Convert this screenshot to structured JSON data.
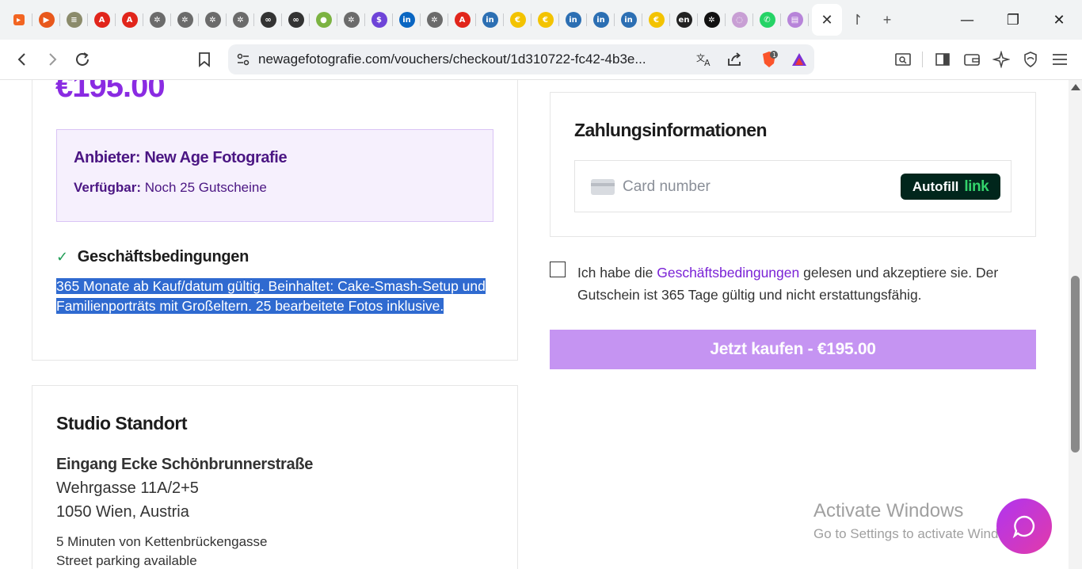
{
  "browser": {
    "tabs": [
      {
        "icon": "framer-icon",
        "glyph": "▸",
        "color": "#f26522"
      },
      {
        "icon": "play-circle-icon",
        "glyph": "▶",
        "color": "#e8581c"
      },
      {
        "icon": "lines-circle-icon",
        "glyph": "≡",
        "color": "#8b8b6b"
      },
      {
        "icon": "adobe-a-icon",
        "glyph": "A",
        "color": "#e1251b"
      },
      {
        "icon": "adobe-a-icon",
        "glyph": "A",
        "color": "#e1251b"
      },
      {
        "icon": "openai-gray-icon",
        "glyph": "✲",
        "color": "#6b6b6b"
      },
      {
        "icon": "openai-gray-icon",
        "glyph": "✲",
        "color": "#6b6b6b"
      },
      {
        "icon": "openai-gray-icon",
        "glyph": "✲",
        "color": "#6b6b6b"
      },
      {
        "icon": "openai-gray-icon",
        "glyph": "✲",
        "color": "#6b6b6b"
      },
      {
        "icon": "infinity-icon",
        "glyph": "∞",
        "color": "#333333"
      },
      {
        "icon": "infinity-icon",
        "glyph": "∞",
        "color": "#333333"
      },
      {
        "icon": "green-circle-icon",
        "glyph": "●",
        "color": "#7cb342"
      },
      {
        "icon": "openai-gray-icon",
        "glyph": "✲",
        "color": "#6b6b6b"
      },
      {
        "icon": "dollar-circle-icon",
        "glyph": "$",
        "color": "#6e44d8"
      },
      {
        "icon": "linkedin-icon",
        "glyph": "in",
        "color": "#0a66c2"
      },
      {
        "icon": "openai-gray-icon",
        "glyph": "✲",
        "color": "#6b6b6b"
      },
      {
        "icon": "adobe-a-icon",
        "glyph": "A",
        "color": "#e1251b"
      },
      {
        "icon": "linkedin-circle-icon",
        "glyph": "in",
        "color": "#2c6fb3"
      },
      {
        "icon": "euro-yellow-icon",
        "glyph": "€",
        "color": "#f3c300"
      },
      {
        "icon": "euro-yellow-icon",
        "glyph": "€",
        "color": "#f3c300"
      },
      {
        "icon": "linkedin-circle-icon",
        "glyph": "in",
        "color": "#2c6fb3"
      },
      {
        "icon": "linkedin-circle-icon",
        "glyph": "in",
        "color": "#2c6fb3"
      },
      {
        "icon": "linkedin-circle-icon",
        "glyph": "in",
        "color": "#2c6fb3"
      },
      {
        "icon": "euro-yellow-icon",
        "glyph": "€",
        "color": "#f3c300"
      },
      {
        "icon": "en-icon",
        "glyph": "en",
        "color": "#222222"
      },
      {
        "icon": "openai-icon",
        "glyph": "✲",
        "color": "#111111"
      },
      {
        "icon": "pink-circle-icon",
        "glyph": "◌",
        "color": "#c89fd4"
      },
      {
        "icon": "whatsapp-icon",
        "glyph": "✆",
        "color": "#25d366"
      },
      {
        "icon": "doc-purple-icon",
        "glyph": "▤",
        "color": "#b784d9"
      }
    ],
    "active_tab_close": "✕",
    "extra_tab": "↾",
    "new_tab": "+",
    "window": {
      "minimize": "—",
      "restore": "❐",
      "close": "✕"
    },
    "url": "newagefotografie.com/vouchers/checkout/1d310722-fc42-4b3e..."
  },
  "voucher": {
    "price": "€195.00",
    "provider_label": "Anbieter: New Age Fotografie",
    "available_label": "Verfügbar:",
    "available_value": "Noch 25 Gutscheine",
    "terms_heading": "Geschäftsbedingungen",
    "terms_text": "365 Monate ab Kauf/datum gültig. Beinhaltet: Cake-Smash-Setup und Familienporträts mit Großeltern. 25 bearbeitete Fotos inklusive."
  },
  "studio": {
    "title": "Studio Standort",
    "entrance": "Eingang Ecke Schönbrunnerstraße",
    "street": "Wehrgasse 11A/2+5",
    "city": "1050 Wien, Austria",
    "transit": "5 Minuten von Kettenbrückengasse",
    "parking": "Street parking available"
  },
  "payment": {
    "title": "Zahlungsinformationen",
    "card_placeholder": "Card number",
    "autofill_label": "Autofill",
    "autofill_brand": "link",
    "agree_prefix": "Ich habe die",
    "agree_link": "Geschäftsbedingungen",
    "agree_suffix": "gelesen und akzeptiere sie. Der Gutschein ist 365 Tage gültig und nicht erstattungsfähig.",
    "buy_button": "Jetzt kaufen - €195.00"
  },
  "os": {
    "activate_title": "Activate Windows",
    "activate_sub": "Go to Settings to activate Windows."
  }
}
